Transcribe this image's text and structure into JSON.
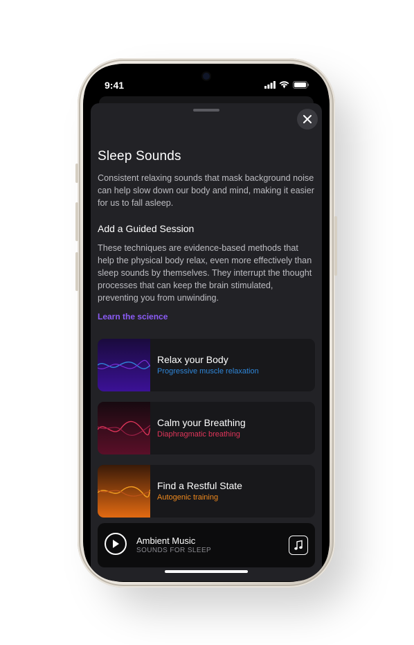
{
  "status": {
    "time": "9:41"
  },
  "sheet": {
    "title": "Sleep Sounds",
    "intro": "Consistent relaxing sounds that mask background noise can help slow down our body and mind, making it easier for us to fall asleep.",
    "section_title": "Add a Guided Session",
    "section_body": "These techniques are evidence-based methods that help the physical body relax, even more effectively than sleep sounds by themselves. They interrupt the thought processes that can keep the brain stimulated, preventing you from unwinding.",
    "learn_link": "Learn the science"
  },
  "sessions": [
    {
      "title": "Relax your Body",
      "subtitle": "Progressive muscle relaxation",
      "accent": "#2f86d8",
      "thumb_top": "#1a0b3d",
      "thumb_bottom": "#3b1196"
    },
    {
      "title": "Calm your Breathing",
      "subtitle": "Diaphragmatic breathing",
      "accent": "#e0355a",
      "thumb_top": "#170a10",
      "thumb_bottom": "#5a0f28"
    },
    {
      "title": "Find a Restful State",
      "subtitle": "Autogenic training",
      "accent": "#f08a1e",
      "thumb_top": "#3a1a08",
      "thumb_bottom": "#e26a12"
    }
  ],
  "player": {
    "title": "Ambient Music",
    "subtitle": "SOUNDS FOR SLEEP"
  },
  "colors": {
    "sheet_bg": "#222226",
    "link": "#8b5cf6"
  }
}
